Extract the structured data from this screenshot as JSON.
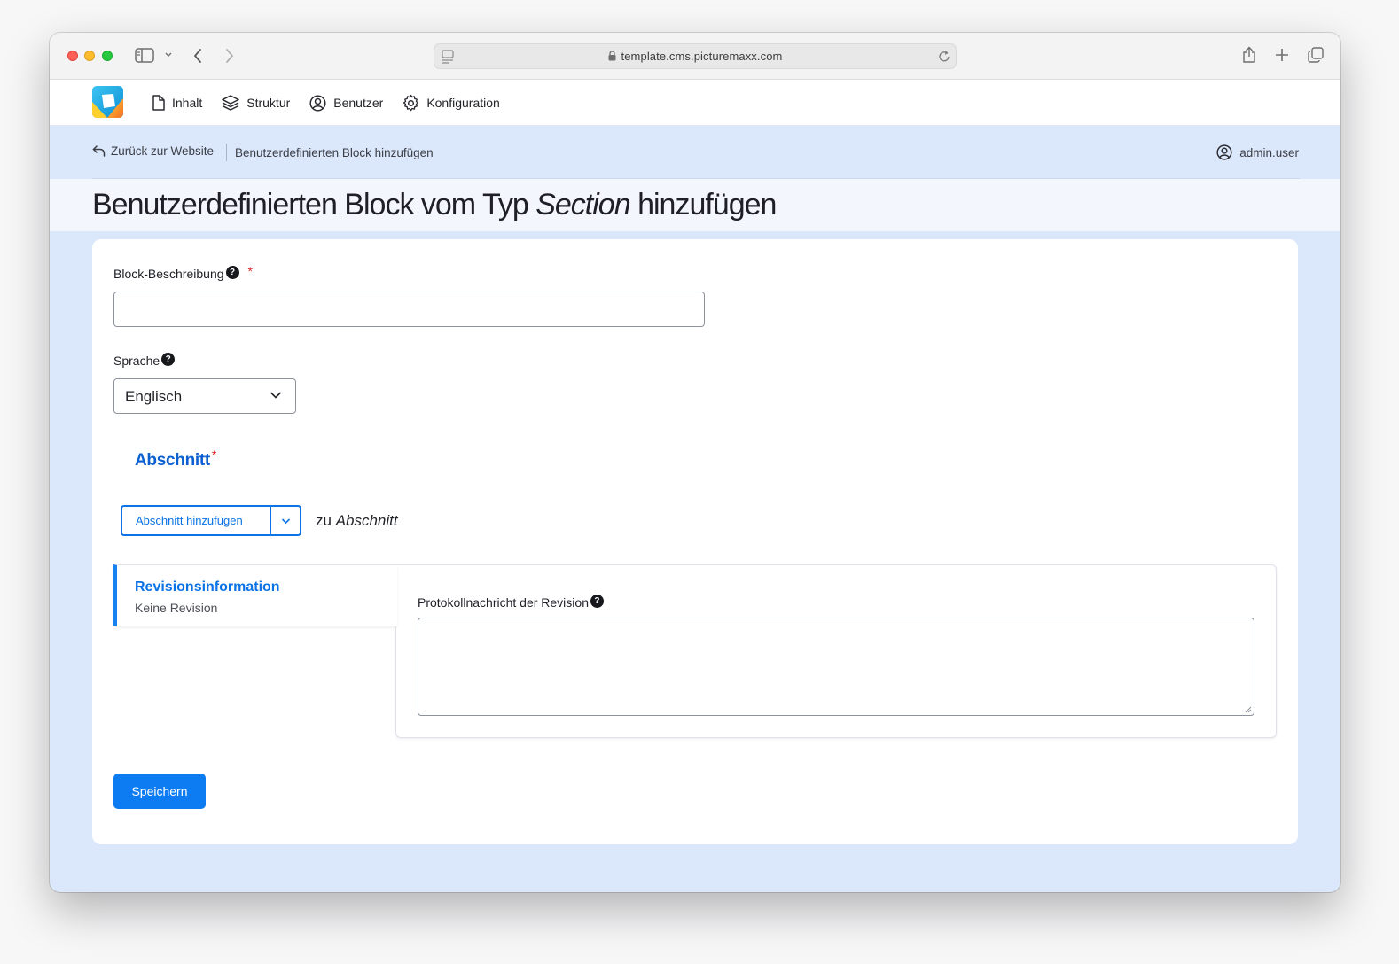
{
  "browser": {
    "url": "template.cms.picturemaxx.com"
  },
  "admin_menu": {
    "items": [
      {
        "label": "Inhalt",
        "icon": "document-icon"
      },
      {
        "label": "Struktur",
        "icon": "layers-icon"
      },
      {
        "label": "Benutzer",
        "icon": "user-circle-icon"
      },
      {
        "label": "Konfiguration",
        "icon": "gear-icon"
      }
    ]
  },
  "breadcrumb": {
    "back_label": "Zurück zur Website",
    "current": "Benutzerdefinierten Block hinzufügen",
    "user": "admin.user"
  },
  "page": {
    "title_before": "Benutzerdefinierten Block vom Typ ",
    "title_type": "Section",
    "title_after": " hinzufügen"
  },
  "form": {
    "description_label": "Block-Beschreibung",
    "description_value": "",
    "required_marker": "*",
    "language_label": "Sprache",
    "language_value": "Englisch",
    "section_title": "Abschnitt",
    "add_section_button": "Abschnitt hinzufügen",
    "to_prefix": "zu ",
    "to_target": "Abschnitt",
    "revision_tab_title": "Revisionsinformation",
    "revision_tab_summary": "Keine Revision",
    "revision_log_label": "Protokollnachricht der Revision",
    "revision_log_value": "",
    "save_button": "Speichern"
  },
  "colors": {
    "accent": "#0d7cf2",
    "link_blue": "#0b73e6",
    "required_red": "#dc2323",
    "page_background": "#dbe8fc"
  }
}
